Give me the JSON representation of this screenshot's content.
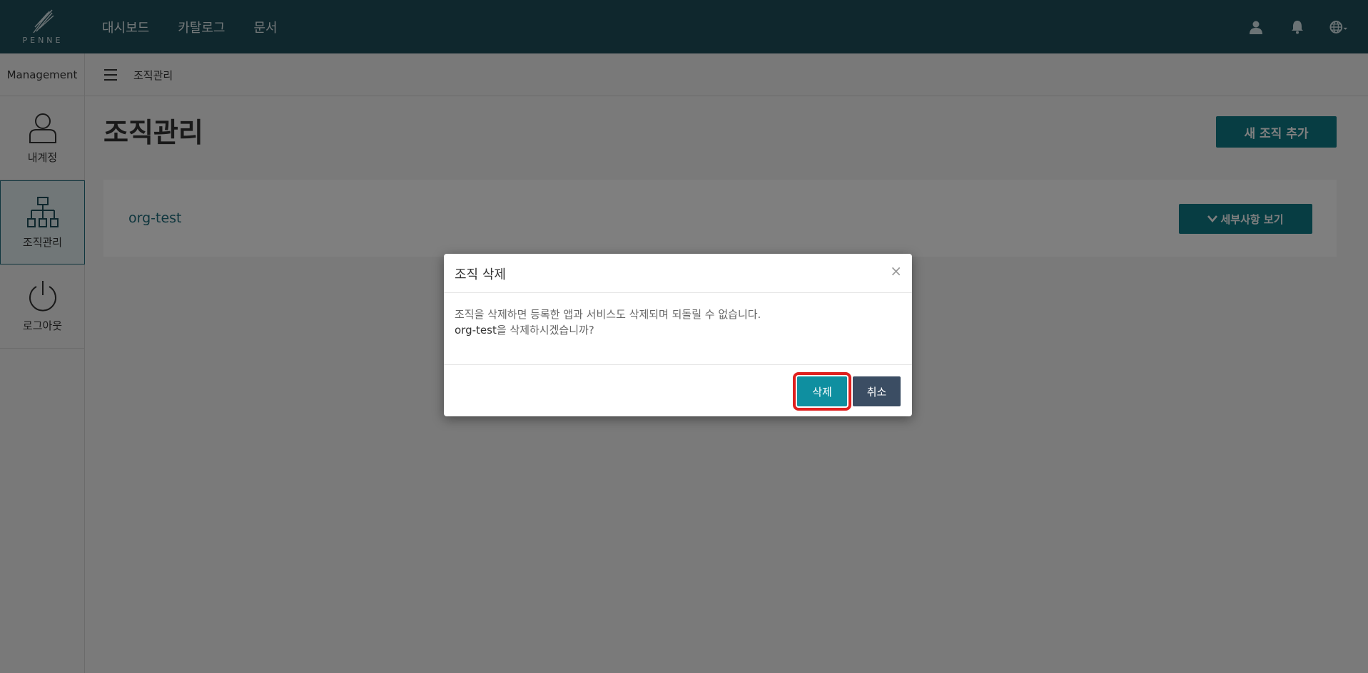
{
  "brand": {
    "logo_text": "PENNE"
  },
  "nav": {
    "items": [
      "대시보드",
      "카탈로그",
      "문서"
    ]
  },
  "top_icons": [
    "user-icon",
    "bell-icon",
    "globe-icon"
  ],
  "subheader": {
    "section": "Management",
    "breadcrumb": "조직관리"
  },
  "sidebar": {
    "items": [
      {
        "label": "내계정",
        "icon": "user-outline-icon",
        "active": false
      },
      {
        "label": "조직관리",
        "icon": "org-chart-icon",
        "active": true
      },
      {
        "label": "로그아웃",
        "icon": "power-icon",
        "active": false
      }
    ]
  },
  "main": {
    "title": "조직관리",
    "add_button": "새 조직 추가",
    "org": {
      "name": "org-test",
      "detail_button": "세부사항 보기"
    }
  },
  "modal": {
    "title": "조직 삭제",
    "message_line1": "조직을 삭제하면 등록한 앱과 서비스도 삭제되며 되돌릴 수 없습니다.",
    "message_org": "org-test",
    "message_line2_suffix": "을 삭제하시겠습니까?",
    "close_symbol": "×",
    "delete_button": "삭제",
    "cancel_button": "취소"
  },
  "colors": {
    "topbar": "#1f4f5b",
    "accent": "#0f7a87",
    "delete_button": "#0f8fa0",
    "cancel_button": "#3b4d63",
    "highlight": "#e0201e"
  }
}
